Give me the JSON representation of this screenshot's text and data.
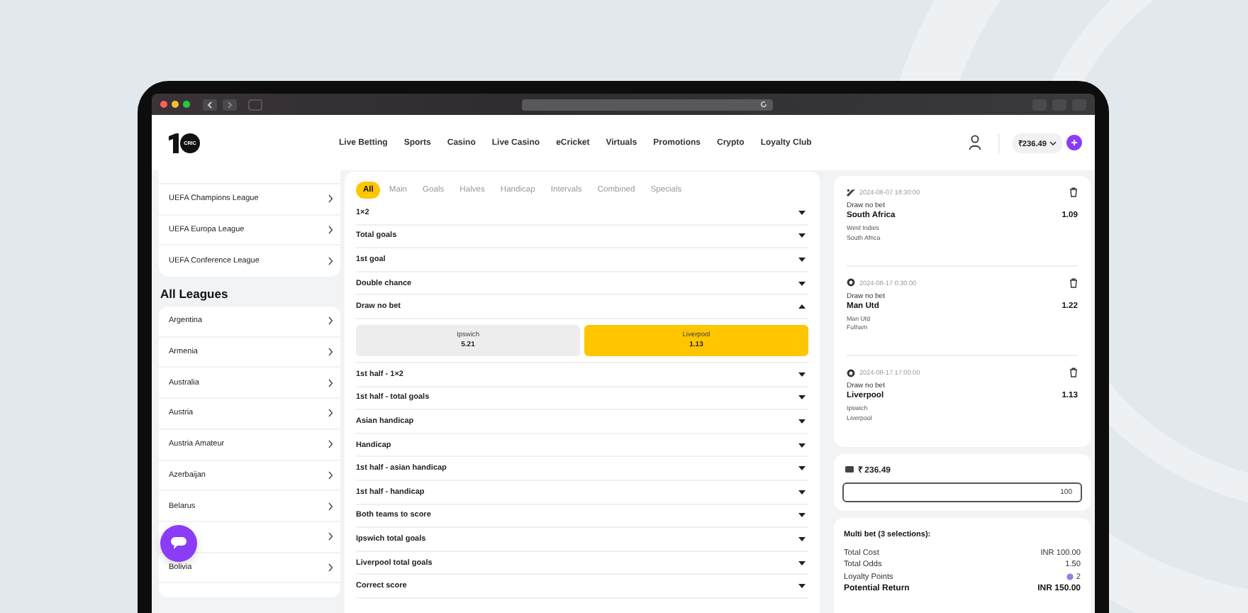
{
  "header": {
    "logo": "CRIC",
    "nav": [
      {
        "label": "Live Betting"
      },
      {
        "label": "Sports"
      },
      {
        "label": "Casino"
      },
      {
        "label": "Live Casino"
      },
      {
        "label": "eCricket"
      },
      {
        "label": "Virtuals"
      },
      {
        "label": "Promotions"
      },
      {
        "label": "Crypto"
      },
      {
        "label": "Loyalty Club"
      }
    ],
    "balance": "₹236.49"
  },
  "sidebar": {
    "top_leagues": [
      "UEFA Champions League",
      "UEFA Europa League",
      "UEFA Conference League"
    ],
    "heading": "All Leagues",
    "leagues": [
      {
        "kind": "row",
        "name": "Argentina"
      },
      {
        "kind": "row",
        "name": "Armenia"
      },
      {
        "kind": "row",
        "name": "Australia"
      },
      {
        "kind": "row",
        "name": "Austria"
      },
      {
        "kind": "row",
        "name": "Austria Amateur"
      },
      {
        "kind": "row",
        "name": "Azerbaijan"
      },
      {
        "kind": "row",
        "name": "Belarus"
      },
      {
        "kind": "covered"
      },
      {
        "kind": "row",
        "name": "Bolivia"
      }
    ]
  },
  "market_tabs": [
    {
      "label": "All",
      "selected": true
    },
    {
      "label": "Main",
      "selected": false
    },
    {
      "label": "Goals",
      "selected": false
    },
    {
      "label": "Halves",
      "selected": false
    },
    {
      "label": "Handicap",
      "selected": false
    },
    {
      "label": "Intervals",
      "selected": false
    },
    {
      "label": "Combined",
      "selected": false
    },
    {
      "label": "Specials",
      "selected": false
    }
  ],
  "markets": [
    {
      "name": "1×2",
      "expanded": false
    },
    {
      "name": "Total goals",
      "expanded": false
    },
    {
      "name": "1st goal",
      "expanded": false
    },
    {
      "name": "Double chance",
      "expanded": false
    },
    {
      "name": "Draw no bet",
      "expanded": true,
      "outcomes": [
        {
          "team": "Ipswich",
          "odds": "5.21",
          "selected": false
        },
        {
          "team": "Liverpool",
          "odds": "1.13",
          "selected": true
        }
      ]
    },
    {
      "name": "1st half - 1×2",
      "expanded": false
    },
    {
      "name": "1st half - total goals",
      "expanded": false
    },
    {
      "name": "Asian handicap",
      "expanded": false
    },
    {
      "name": "Handicap",
      "expanded": false
    },
    {
      "name": "1st half - asian handicap",
      "expanded": false
    },
    {
      "name": "1st half - handicap",
      "expanded": false
    },
    {
      "name": "Both teams to score",
      "expanded": false
    },
    {
      "name": "Ipswich total goals",
      "expanded": false
    },
    {
      "name": "Liverpool total goals",
      "expanded": false
    },
    {
      "name": "Correct score",
      "expanded": false
    }
  ],
  "betslip": {
    "bets": [
      {
        "kind": "cricket",
        "time": "2024-08-07 18:30:00",
        "market": "Draw no bet",
        "pick": "South Africa",
        "odds": "1.09",
        "teams": [
          "West Indies",
          "South Africa"
        ]
      },
      {
        "kind": "football",
        "time": "2024-08-17 0:30:00",
        "market": "Draw no bet",
        "pick": "Man Utd",
        "odds": "1.22",
        "teams": [
          "Man Utd",
          "Fulham"
        ]
      },
      {
        "kind": "football",
        "time": "2024-08-17 17:00:00",
        "market": "Draw no bet",
        "pick": "Liverpool",
        "odds": "1.13",
        "teams": [
          "Ipswich",
          "Liverpool"
        ]
      }
    ],
    "balance": "₹ 236.49",
    "stake": "100",
    "summary_title": "Multi bet (3 selections):",
    "summary": [
      {
        "kind": "plain",
        "label": "Total Cost",
        "value": "INR 100.00"
      },
      {
        "kind": "plain",
        "label": "Total Odds",
        "value": "1.50"
      },
      {
        "kind": "points",
        "label": "Loyalty Points",
        "value": "2"
      },
      {
        "kind": "total",
        "label": "Potential Return",
        "value": "INR 150.00"
      }
    ]
  }
}
